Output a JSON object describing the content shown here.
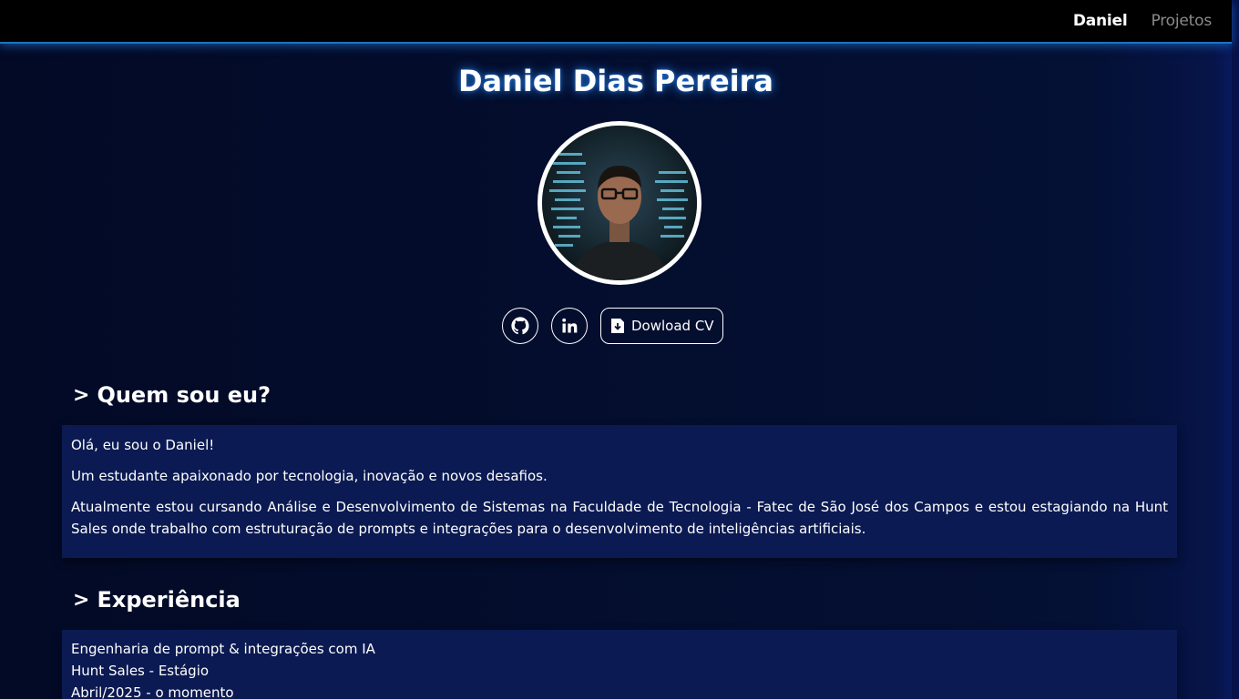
{
  "nav": {
    "items": [
      {
        "label": "Daniel",
        "active": true
      },
      {
        "label": "Projetos",
        "active": false
      }
    ]
  },
  "profile": {
    "name": "Daniel Dias Pereira",
    "avatar_icon": "profile-photo",
    "links": {
      "github_icon": "github-icon",
      "linkedin_icon": "linkedin-icon",
      "cv_icon": "file-download-icon",
      "cv_label": "Dowload CV"
    }
  },
  "about": {
    "heading_chevron": ">",
    "heading": "Quem sou eu?",
    "greeting": "Olá, eu sou o Daniel!",
    "tagline": "Um estudante apaixonado por tecnologia, inovação e novos desafios.",
    "paragraph": "Atualmente estou cursando Análise e Desenvolvimento de Sistemas na Faculdade de Tecnologia - Fatec de São José dos Campos e estou estagiando na Hunt Sales onde trabalho com estruturação de prompts e integrações para o desenvolvimento de inteligências artificiais."
  },
  "experience": {
    "heading_chevron": ">",
    "heading": "Experiência",
    "items": [
      {
        "role": "Engenharia de prompt & integrações com IA",
        "company": "Hunt Sales - Estágio",
        "period": "Abril/2025 - o momento"
      }
    ]
  },
  "colors": {
    "background": "#041034",
    "card": "#0b1a52",
    "topbar": "#000000",
    "accent_glow": "#1a74c4",
    "nav_inactive": "#8a8a8a"
  }
}
